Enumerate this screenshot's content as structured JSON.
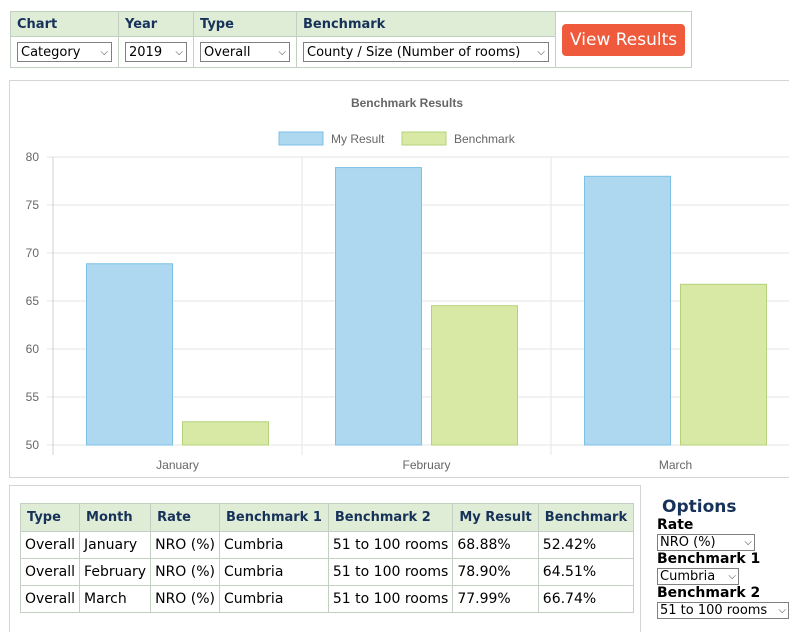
{
  "filters": {
    "headers": [
      "Chart",
      "Year",
      "Type",
      "Benchmark"
    ],
    "chart_select": "Category",
    "year_select": "2019",
    "type_select": "Overall",
    "benchmark_select": "County / Size (Number of rooms)",
    "view_button": "View Results"
  },
  "chart_data": {
    "type": "bar",
    "title": "Benchmark Results",
    "categories": [
      "January",
      "February",
      "March"
    ],
    "series": [
      {
        "name": "My Result",
        "values": [
          68.88,
          78.9,
          77.99
        ],
        "color": "#aed8f0",
        "stroke": "#7cc0e6"
      },
      {
        "name": "Benchmark",
        "values": [
          52.42,
          64.51,
          66.74
        ],
        "color": "#d8e9a6",
        "stroke": "#b5d27a"
      }
    ],
    "ylim": [
      50,
      80
    ],
    "yticks": [
      80,
      75,
      70,
      65,
      60,
      55,
      50
    ],
    "grid": true,
    "legend_position": "top"
  },
  "results": {
    "headers": [
      "Type",
      "Month",
      "Rate",
      "Benchmark 1",
      "Benchmark 2",
      "My Result",
      "Benchmark"
    ],
    "rows": [
      [
        "Overall",
        "January",
        "NRO (%)",
        "Cumbria",
        "51 to 100 rooms",
        "68.88%",
        "52.42%"
      ],
      [
        "Overall",
        "February",
        "NRO (%)",
        "Cumbria",
        "51 to 100 rooms",
        "78.90%",
        "64.51%"
      ],
      [
        "Overall",
        "March",
        "NRO (%)",
        "Cumbria",
        "51 to 100 rooms",
        "77.99%",
        "66.74%"
      ]
    ]
  },
  "options": {
    "title": "Options",
    "rate_label": "Rate",
    "rate_value": "NRO (%)",
    "benchmark1_label": "Benchmark 1",
    "benchmark1_value": "Cumbria",
    "benchmark2_label": "Benchmark 2",
    "benchmark2_value": "51 to 100 rooms"
  }
}
